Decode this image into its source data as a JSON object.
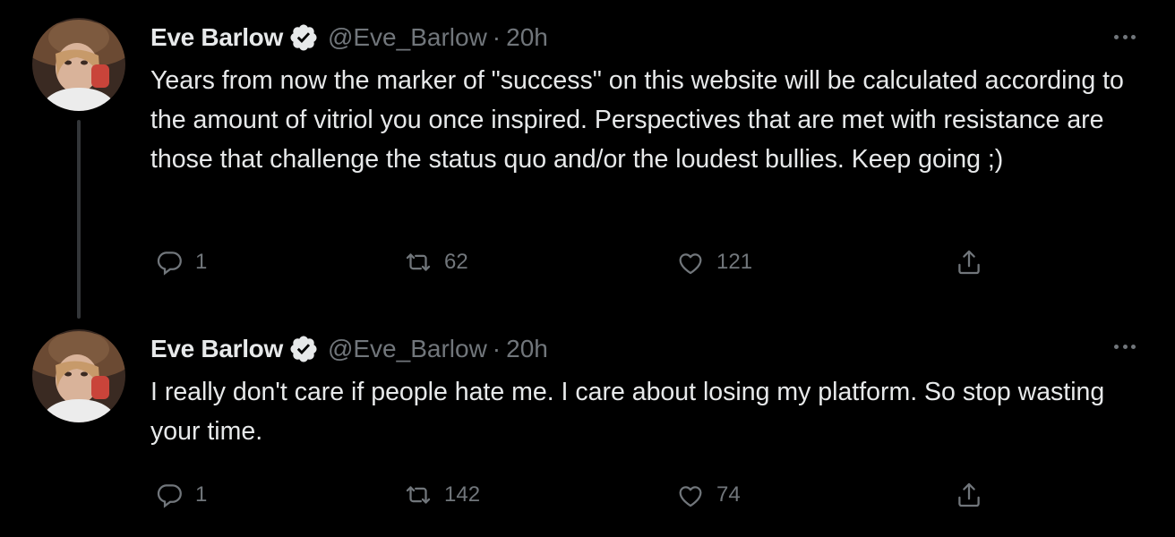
{
  "colors": {
    "background": "#000000",
    "text": "#e7e9ea",
    "secondary": "#71767b",
    "verified": "#e7e9ea",
    "thread_line": "#333639"
  },
  "tweets": [
    {
      "author": {
        "name": "Eve Barlow",
        "handle": "@Eve_Barlow",
        "verified_icon": "verified-badge-icon"
      },
      "separator": "·",
      "time": "20h",
      "text": "Years from now the marker of \"success\" on this website will be calculated according to the amount of vitriol you once inspired. Perspectives that are met with resistance are those that challenge the status quo and/or the loudest bullies. Keep going ;)",
      "replies": "1",
      "retweets": "62",
      "likes": "121"
    },
    {
      "author": {
        "name": "Eve Barlow",
        "handle": "@Eve_Barlow",
        "verified_icon": "verified-badge-icon"
      },
      "separator": "·",
      "time": "20h",
      "text": "I really don't care if people hate me. I care about losing my platform. So stop wasting your time.",
      "replies": "1",
      "retweets": "142",
      "likes": "74"
    }
  ]
}
